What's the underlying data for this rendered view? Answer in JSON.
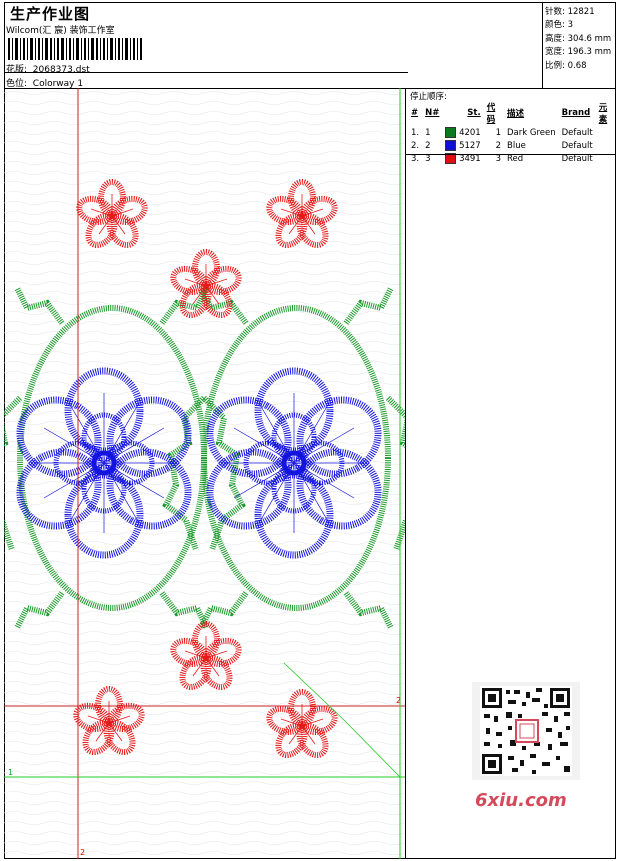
{
  "header": {
    "title": "生产作业图",
    "studio": "Wilcom(汇 宸) 装饰工作室",
    "design_label": "花版:",
    "design_value": "2068373.dst",
    "colorway_label": "色位:",
    "colorway_value": "Colorway 1"
  },
  "stats": {
    "stitches_label": "针数:",
    "stitches_value": "12821",
    "colors_label": "颜色:",
    "colors_value": "3",
    "height_label": "高度:",
    "height_value": "304.6 mm",
    "width_label": "宽度:",
    "width_value": "196.3 mm",
    "scale_label": "比例:",
    "scale_value": "0.68"
  },
  "stop_sequence": {
    "heading": "停止顺序:",
    "columns": [
      "#",
      "N#",
      "St.",
      "代码",
      "描述",
      "Brand",
      "元素"
    ],
    "rows": [
      {
        "idx": "1.",
        "n": "1",
        "color": "#0a7a1e",
        "st": "4201",
        "code": "1",
        "desc": "Dark Green",
        "brand": "Default"
      },
      {
        "idx": "2.",
        "n": "2",
        "color": "#1010d0",
        "st": "5127",
        "code": "2",
        "desc": "Blue",
        "brand": "Default"
      },
      {
        "idx": "3.",
        "n": "3",
        "color": "#e01010",
        "st": "3491",
        "code": "3",
        "desc": "Red",
        "brand": "Default"
      }
    ]
  },
  "guides": {
    "label_1": "1",
    "label_2": "2"
  },
  "watermark": "6xiu.com",
  "colors": {
    "green": "#1a9a2a",
    "blue": "#1414e0",
    "red": "#e81818",
    "guide_green": "#22cc22",
    "guide_red": "#cc2222"
  }
}
